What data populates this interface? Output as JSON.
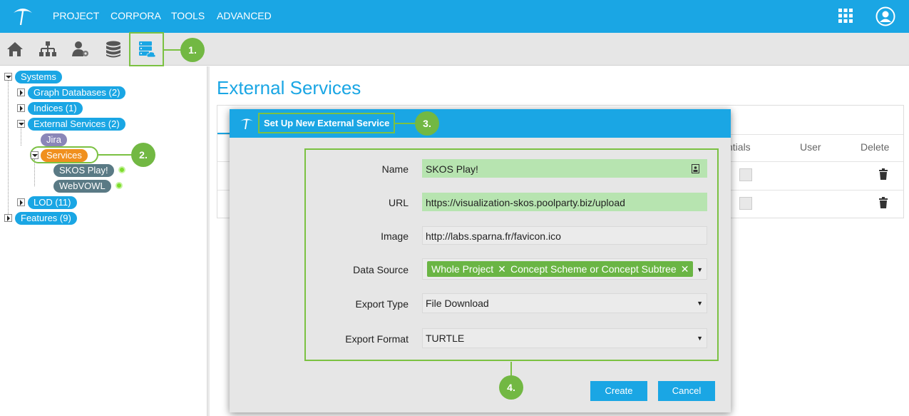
{
  "topbar": {
    "menu": [
      "PROJECT",
      "CORPORA",
      "TOOLS",
      "ADVANCED"
    ],
    "apps_icon": "apps-grid-icon",
    "user_icon": "user-avatar-icon",
    "color": "#1aa6e4"
  },
  "toolbar": {
    "icons": [
      "home-icon",
      "hierarchy-icon",
      "user-settings-icon",
      "database-icon",
      "database-cloud-icon"
    ]
  },
  "callouts": [
    "1.",
    "2.",
    "3.",
    "4."
  ],
  "tree": {
    "systems": "Systems",
    "graph_databases": "Graph Databases (2)",
    "indices": "Indices (1)",
    "external_services": "External Services (2)",
    "jira": "Jira",
    "services": "Services",
    "skos_play": "SKOS Play!",
    "webvowl": "WebVOWL",
    "lod": "LOD (11)",
    "features": "Features (9)"
  },
  "main": {
    "title": "External Services",
    "table_headers": {
      "credentials_partial": "ntials",
      "user": "User",
      "delete": "Delete"
    }
  },
  "dialog": {
    "title": "Set Up New External Service",
    "fields": {
      "name": {
        "label": "Name",
        "value": "SKOS Play!"
      },
      "url": {
        "label": "URL",
        "value": "https://visualization-skos.poolparty.biz/upload"
      },
      "image": {
        "label": "Image",
        "value": "http://labs.sparna.fr/favicon.ico"
      },
      "data_source": {
        "label": "Data Source",
        "tags": [
          "Whole Project",
          "Concept Scheme or Concept Subtree"
        ]
      },
      "export_type": {
        "label": "Export Type",
        "value": "File Download"
      },
      "export_format": {
        "label": "Export Format",
        "value": "TURTLE"
      }
    },
    "create_label": "Create",
    "cancel_label": "Cancel"
  }
}
